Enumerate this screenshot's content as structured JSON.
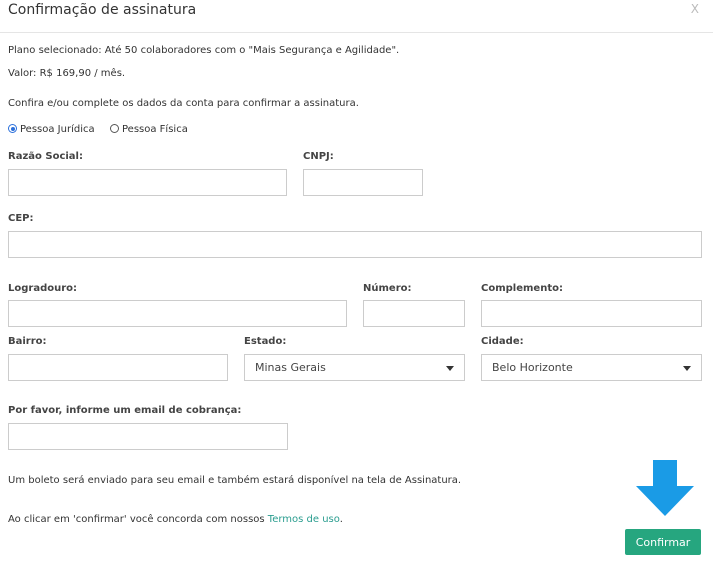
{
  "modal": {
    "title": "Confirmação de assinatura",
    "close_label": "X"
  },
  "plan": {
    "selected_label": "Plano selecionado:",
    "selected_value": "Até 50 colaboradores com o \"Mais Segurança e Agilidade\".",
    "price_label": "Valor:",
    "price_value": "R$ 169,90 / mês."
  },
  "instructions": "Confira e/ou complete os dados da conta para confirmar a assinatura.",
  "person_type": {
    "options": [
      "Pessoa Jurídica",
      "Pessoa Física"
    ],
    "selected": "Pessoa Jurídica"
  },
  "fields": {
    "razao_social": {
      "label": "Razão Social:",
      "value": ""
    },
    "cnpj": {
      "label": "CNPJ:",
      "value": ""
    },
    "cep": {
      "label": "CEP:",
      "value": ""
    },
    "logradouro": {
      "label": "Logradouro:",
      "value": ""
    },
    "numero": {
      "label": "Número:",
      "value": ""
    },
    "complemento": {
      "label": "Complemento:",
      "value": ""
    },
    "bairro": {
      "label": "Bairro:",
      "value": ""
    },
    "estado": {
      "label": "Estado:",
      "value": "Minas Gerais"
    },
    "cidade": {
      "label": "Cidade:",
      "value": "Belo Horizonte"
    },
    "email": {
      "label": "Por favor, informe um email de cobrança:",
      "value": ""
    }
  },
  "footer": {
    "boleto_note": "Um boleto será enviado para seu email e também estará disponível na tela de Assinatura.",
    "terms_prefix": "Ao clicar em 'confirmar' você concorda com nossos ",
    "terms_link": "Termos de uso",
    "terms_suffix": ".",
    "confirm_label": "Confirmar"
  },
  "colors": {
    "confirm_button": "#26a67f",
    "arrow": "#1a9be6",
    "link": "#2a9d8f"
  }
}
